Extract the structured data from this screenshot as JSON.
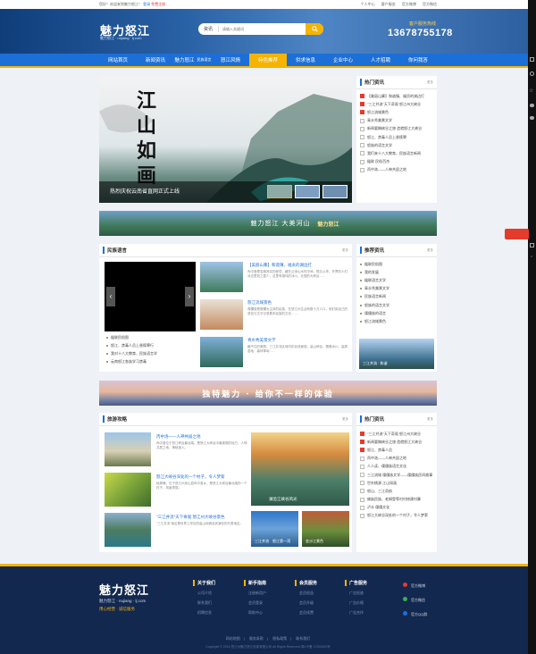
{
  "topbar": {
    "welcome": "您好！欢迎来到魅力怒江！",
    "login": "登录",
    "register": "免费注册",
    "links": [
      "个人中心",
      "客户服务",
      "官方微博",
      "官方微信"
    ]
  },
  "header": {
    "logo": "魅力怒江",
    "logo_sub": "魅力怒江 · nujiang · lj.com",
    "search_type": "资讯",
    "search_placeholder": "请输入关键词",
    "hotline_label": "客户服务热线",
    "hotline": "13678755178"
  },
  "nav": [
    "网站首页",
    "新闻资讯",
    "魅力怒江",
    "民族语言",
    "怒江风情",
    "特色推荐",
    "供求信息",
    "企业中心",
    "人才招聘",
    "你问我答"
  ],
  "slider": {
    "caption": "热烈庆祝云南省直网正式上线",
    "title_art": "江山如画"
  },
  "hot_news": {
    "title": "热门资讯",
    "more": "更多",
    "items": [
      "【美丽山寨】和谐镇、福贡的湖边打",
      "\"三江并流\"天下奇观 怒江州大峡谷",
      "怒江流域景色",
      "青水秀美景文学",
      "新闻要稿峡谷之旅 造就怒江大峡谷",
      "怒江、禁毒人员上香赎罪",
      "怒族的语言文学",
      "我们来十八大教育，民族语言新闻",
      "楹联 民俗百杰",
      "丙中洛——人神共居之地"
    ]
  },
  "banner1": {
    "title": "魅力怒江  大美河山",
    "sub": "魅力怒江"
  },
  "lang": {
    "title": "民族语言",
    "more": "更多",
    "articles": [
      {
        "title": "【美丽山寨】和谐镇、福贡的湖边打",
        "desc": "丙中洛是名副其实的秘境，藏在云深山水的中间，很久以来，外界的人们对这里知之甚少，这里有雄伟的冰川、壮丽的大峡谷……"
      },
      {
        "title": "怒江流域景色",
        "desc": "傈僳族是傈僳为主体的民族，在怒江州生活有数十万人口，他们用自己的语言与文字记录着本民族的文化……"
      },
      {
        "title": "青水秀美景文学",
        "desc": "藏不住的美丽，三江并流区域内的自然景观，高山峡谷、雪峰冰川、高原湿地、森林草甸……"
      }
    ],
    "links": [
      "楹联民俗图",
      "怒江、禁毒人员上香赎罪行",
      "我对十八大教育、民族语言学",
      "云南怒江各族学习禁毒",
      "用少数民族语言宣传"
    ]
  },
  "recommend": {
    "title": "推荐资讯",
    "more": "更多",
    "items": [
      "楹联民俗图",
      "我的发展",
      "楹联语言文学",
      "青水秀美景文学",
      "民族语言新闻",
      "怒族的语言文学",
      "傈僳族的语言",
      "怒江流域景色"
    ],
    "photo_caption": "三江并流 · 和谐"
  },
  "banner2": {
    "title": "独特魅力 · 给你不一样的体验"
  },
  "travel": {
    "title": "旅游攻略",
    "more": "更多",
    "articles": [
      {
        "title": "丙中洛——人神共居之地",
        "desc": "丙中洛位于怒江峡谷最北端，是怒江大峡谷中最美丽的地方，人神共居之地，神秘迷人。"
      },
      {
        "title": "怒江大峡谷深处的一个村子，令人梦萦",
        "desc": "秋那桶，位于怒江州贡山县丙中洛乡，是怒江大峡谷最北端的一个村子，风景秀丽。"
      },
      {
        "title": "\"三江并流\"天下奇观 怒江州大峡谷景色",
        "desc": "\"三江并流\"地区是世界上罕见的高山地貌及其演化的代表地区。"
      }
    ],
    "photos": [
      "澜沧江峡谷风光",
      "三江并流",
      "怒江第一湾",
      "金沙江景色"
    ]
  },
  "hot2": {
    "title": "热门资讯",
    "more": "更多",
    "items": [
      "\"三江并流\"天下奇观 怒江州大峡谷",
      "新闻要稿峡谷之旅 造就怒江大峡谷",
      "怒江、禁毒人员",
      "丙中洛——人神共居之地",
      "人人读、傈僳族语言文化",
      "三江流域 傈僳族文学——傈僳族民间故事",
      "世外桃源 江山如画",
      "怒山、三江奇韵",
      "傣族民族、老姆登等村村修建村寨",
      "泸水 傈僳文化",
      "怒江大峡谷深处的一个村子，令人梦萦"
    ]
  },
  "footer": {
    "logo": "魅力怒江",
    "sub": "魅力怒江 · nujiang · lj.com",
    "slogan": "用心经营 · 诚信服务",
    "cols": [
      {
        "h": "关于我们",
        "items": [
          "公司介绍",
          "联系我们",
          "招聘信息"
        ]
      },
      {
        "h": "新手指南",
        "items": [
          "注册新用户",
          "会员登录",
          "帮助中心"
        ]
      },
      {
        "h": "会员服务",
        "items": [
          "会员权益",
          "会员升级",
          "会员续费"
        ]
      },
      {
        "h": "广告服务",
        "items": [
          "广告投放",
          "广告价格",
          "广告合作"
        ]
      }
    ],
    "social": [
      "官方微博",
      "官方微信",
      "官方QQ群"
    ],
    "links": [
      "网站地图",
      "服务条款",
      "隐私政策",
      "联系我们"
    ],
    "copyright": "Copyright © 2016 怒江州魅力怒江信息有限公司 All Rights Reserved  滇ICP备  17000000号"
  }
}
